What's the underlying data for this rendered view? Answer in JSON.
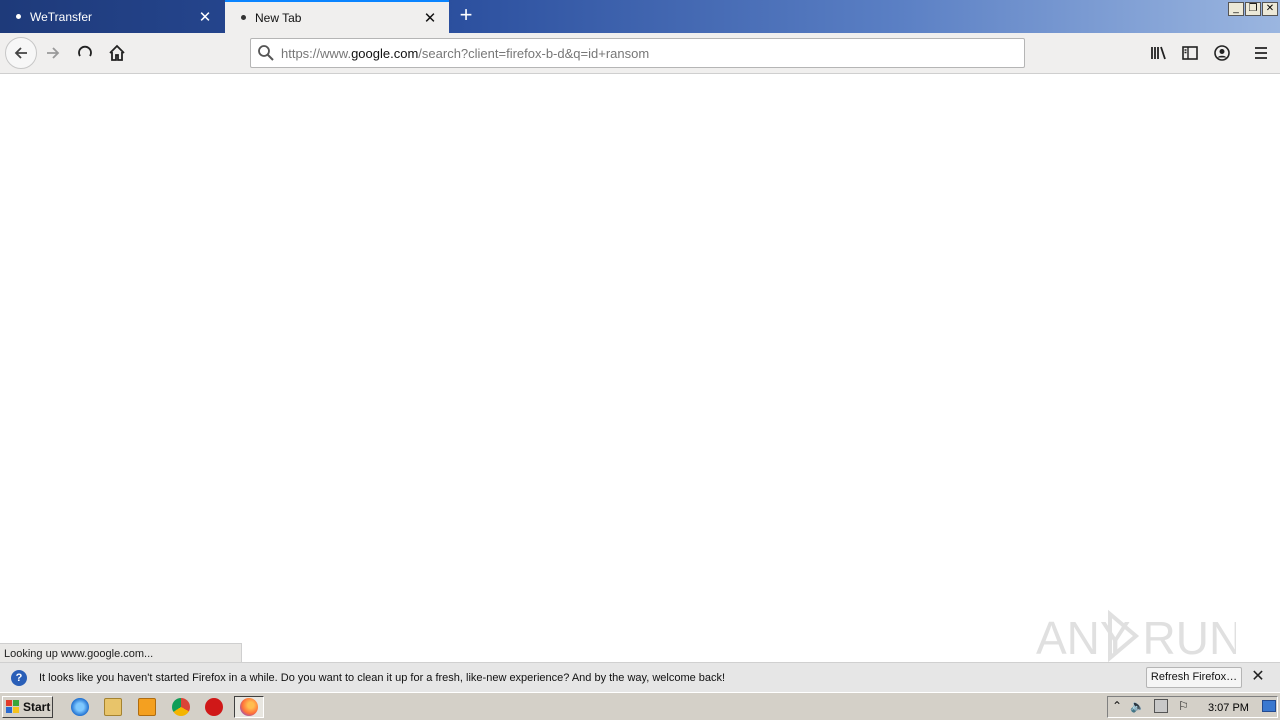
{
  "tabs": [
    {
      "label": "WeTransfer",
      "active": false
    },
    {
      "label": "New Tab",
      "active": true
    }
  ],
  "window_controls": {
    "minimize": "_",
    "restore": "❐",
    "close": "✕"
  },
  "navbar": {
    "url_scheme_prefix": "https://www.",
    "url_host": "google.com",
    "url_path": "/search?client=firefox-b-d&q=id+ransom"
  },
  "status": {
    "text": "Looking up www.google.com..."
  },
  "notification": {
    "text": "It looks like you haven't started Firefox in a while. Do you want to clean it up for a fresh, like-new experience? And by the way, welcome back!",
    "button_label": "Refresh Firefox…"
  },
  "watermark": {
    "text": "ANY RUN"
  },
  "taskbar": {
    "start_label": "Start",
    "clock": "3:07 PM",
    "quicklaunch": [
      "ie-icon",
      "explorer-icon",
      "media-player-icon",
      "chrome-icon",
      "opera-icon"
    ]
  },
  "colors": {
    "accent": "#0a84ff",
    "tabbar_dark": "#1e3a7a",
    "chrome_bg": "#f0efee"
  }
}
